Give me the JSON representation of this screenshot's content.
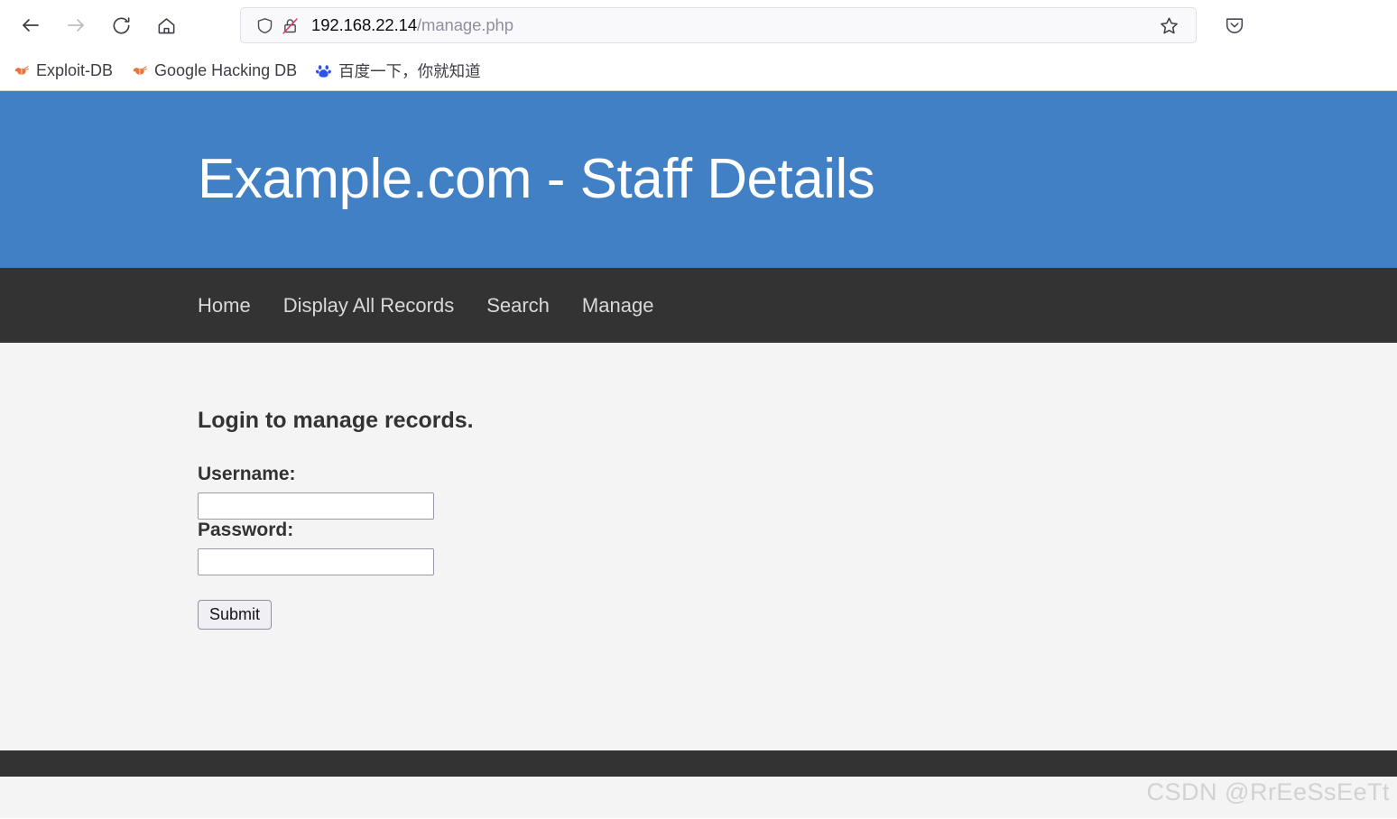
{
  "browser": {
    "toolbar": {
      "back_icon": "back-arrow-icon",
      "forward_icon": "forward-arrow-icon",
      "reload_icon": "reload-icon",
      "home_icon": "home-icon",
      "shield_icon": "tracking-protection-shield-icon",
      "lock_icon": "insecure-connection-lock-icon",
      "star_icon": "bookmark-star-icon",
      "pocket_icon": "pocket-save-icon"
    },
    "url": {
      "host": "192.168.22.14",
      "path": "/manage.php",
      "full": "192.168.22.14/manage.php"
    },
    "bookmarks": [
      {
        "label": "Exploit-DB",
        "icon": "exploit-db-bug-icon"
      },
      {
        "label": "Google Hacking DB",
        "icon": "exploit-db-bug-icon"
      },
      {
        "label": "百度一下，你就知道",
        "icon": "baidu-paw-icon"
      }
    ]
  },
  "page": {
    "header": {
      "title": "Example.com - Staff Details",
      "background_color": "#4180c4",
      "text_color": "#ffffff"
    },
    "nav": {
      "background_color": "#333333",
      "items": [
        {
          "label": "Home"
        },
        {
          "label": "Display All Records"
        },
        {
          "label": "Search"
        },
        {
          "label": "Manage"
        }
      ]
    },
    "main": {
      "heading": "Login to manage records.",
      "background_color": "#f4f4f4",
      "form": {
        "username": {
          "label": "Username:",
          "value": "",
          "placeholder": ""
        },
        "password": {
          "label": "Password:",
          "value": "",
          "placeholder": ""
        },
        "submit_label": "Submit"
      }
    },
    "footer": {
      "background_color": "#333333"
    },
    "watermark": "CSDN @RrEeSsEeTt"
  }
}
